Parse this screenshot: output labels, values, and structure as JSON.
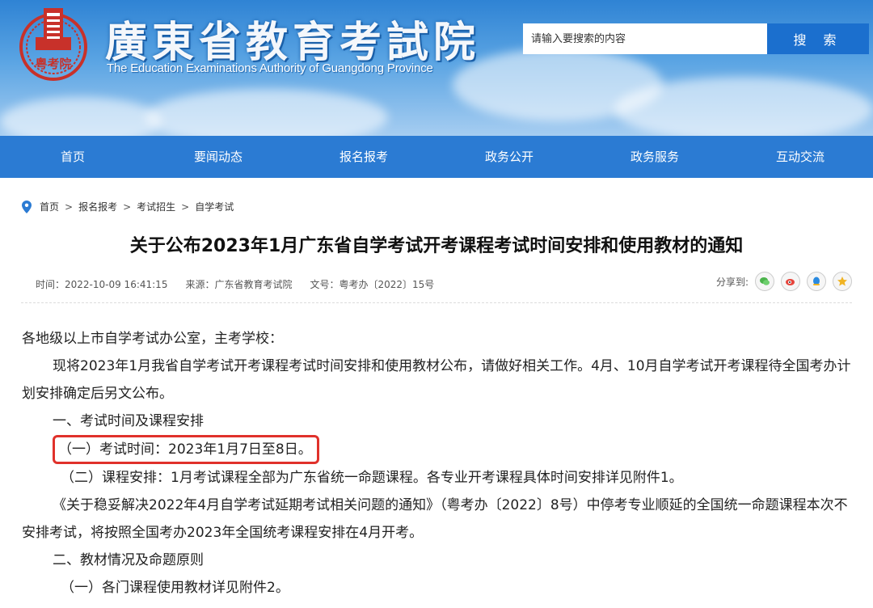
{
  "header": {
    "title": "廣東省教育考試院",
    "subtitle": "The Education Examinations Authority of Guangdong Province",
    "logo_text": "粤考院",
    "search_placeholder": "请输入要搜索的内容",
    "search_button": "搜 索"
  },
  "nav": [
    "首页",
    "要闻动态",
    "报名报考",
    "政务公开",
    "政务服务",
    "互动交流"
  ],
  "breadcrumb": [
    "首页",
    "报名报考",
    "考试招生",
    "自学考试"
  ],
  "article": {
    "title": "关于公布2023年1月广东省自学考试开考课程考试时间安排和使用教材的通知",
    "time": "时间：2022-10-09 16:41:15",
    "source": "来源：广东省教育考试院",
    "doc_no": "文号：粤考办〔2022〕15号",
    "share_label": "分享到:",
    "share_icons": [
      "wechat-icon",
      "weibo-icon",
      "qq-icon",
      "qzone-icon"
    ],
    "paragraphs": {
      "p1": "各地级以上市自学考试办公室，主考学校：",
      "p2": "现将2023年1月我省自学考试开考课程考试时间安排和使用教材公布，请做好相关工作。4月、10月自学考试开考课程待全国考办计划安排确定后另文公布。",
      "h1": "一、考试时间及课程安排",
      "s1": "（一）考试时间：2023年1月7日至8日。",
      "s2": "（二）课程安排：1月考试课程全部为广东省统一命题课程。各专业开考课程具体时间安排详见附件1。",
      "p3": "《关于稳妥解决2022年4月自学考试延期考试相关问题的通知》（粤考办〔2022〕8号）中停考专业顺延的全国统一命题课程本次不安排考试，将按照全国考办2023年全国统考课程安排在4月开考。",
      "h2": "二、教材情况及命题原则",
      "s3": "（一）各门课程使用教材详见附件2。"
    }
  },
  "colors": {
    "nav": "#2b7bd3",
    "search_button": "#1b6fce",
    "highlight_border": "#e0312b",
    "logo_red": "#c8312a"
  }
}
